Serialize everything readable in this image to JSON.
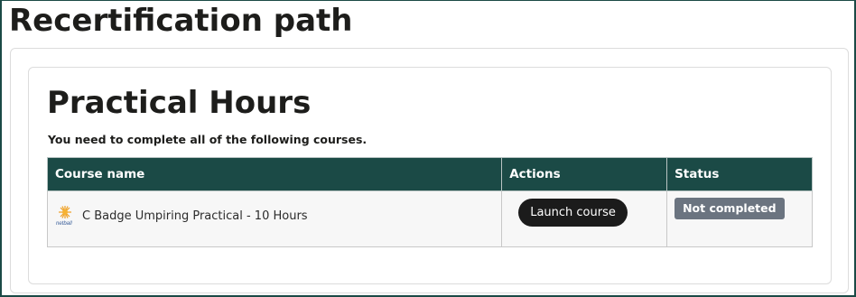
{
  "page": {
    "title": "Recertification path"
  },
  "section": {
    "title": "Practical Hours",
    "instruction": "You need to complete all of the following courses."
  },
  "table": {
    "headers": {
      "course_name": "Course name",
      "actions": "Actions",
      "status": "Status"
    },
    "rows": [
      {
        "logo": "netball-logo",
        "logo_text": "netball",
        "course_name": "C Badge Umpiring Practical - 10 Hours",
        "action_label": "Launch course",
        "status": "Not completed"
      }
    ]
  },
  "colors": {
    "header_bg": "#1b4a46",
    "button_bg": "#1b1b1b",
    "status_badge_bg": "#6b7480",
    "frame_border": "#1b4a46"
  }
}
